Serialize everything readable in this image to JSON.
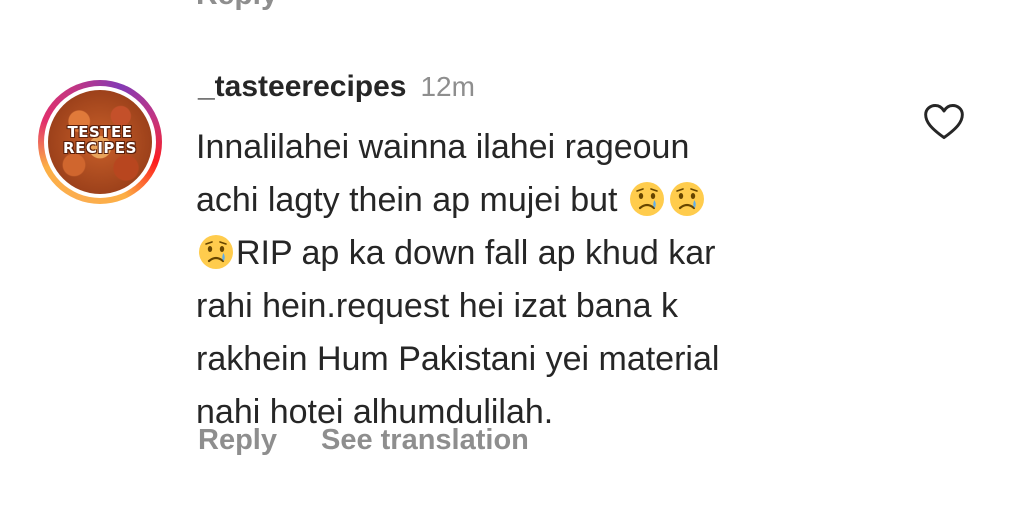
{
  "previous_comment": {
    "reply_label": "Reply"
  },
  "comment": {
    "avatar": {
      "logo_text_line1": "TESTEE",
      "logo_text_line2": "RECIPES",
      "ring_colors": [
        "#fbad50",
        "#e1306c",
        "#c13584",
        "#833ab4"
      ]
    },
    "username": "_tasteerecipes",
    "timestamp": "12m",
    "text_lines": [
      "Innalilahei wainna ilahei rageoun",
      "achi lagty thein ap mujei but",
      "RIP ap ka down fall ap khud kar",
      "rahi hein.request hei izat bana k",
      "rakhein Hum Pakistani yei material",
      "nahi hotei alhumdulilah."
    ],
    "emojis": [
      "crying-face-emoji",
      "crying-face-emoji",
      "crying-face-emoji"
    ],
    "actions": {
      "reply_label": "Reply",
      "translate_label": "See translation"
    },
    "like_icon": "heart-outline-icon"
  },
  "colors": {
    "text_primary": "#262626",
    "text_secondary": "#8e8e8e",
    "background": "#ffffff"
  }
}
